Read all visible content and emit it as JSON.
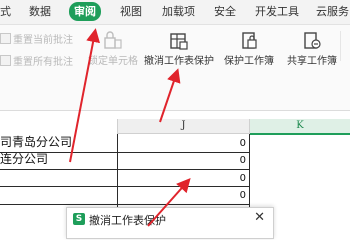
{
  "menu": {
    "items": [
      "式",
      "数据",
      "审阅",
      "视图",
      "加载项",
      "安全",
      "开发工具",
      "云服务"
    ],
    "active_index": 2
  },
  "ribbon": {
    "small_buttons": [
      "重置当前批注",
      "重置所有批注"
    ],
    "lock_cell": "锁定单元格",
    "unprotect_sheet": "撤消工作表保护",
    "protect_workbook": "保护工作簿",
    "share_workbook": "共享工作簿"
  },
  "grid": {
    "columns": [
      "J",
      "K"
    ],
    "rows": [
      {
        "text": "司青岛分公司",
        "value": "0"
      },
      {
        "text": "连分公司",
        "value": "0"
      },
      {
        "text": "",
        "value": "0"
      },
      {
        "text": "",
        "value": "0"
      },
      {
        "text": "",
        "value": "0"
      }
    ]
  },
  "dialog": {
    "title": "撤消工作表保护",
    "close": "✕",
    "icon_letter": "S"
  },
  "colors": {
    "accent": "#1e9e5a",
    "arrow": "#e0242c"
  }
}
